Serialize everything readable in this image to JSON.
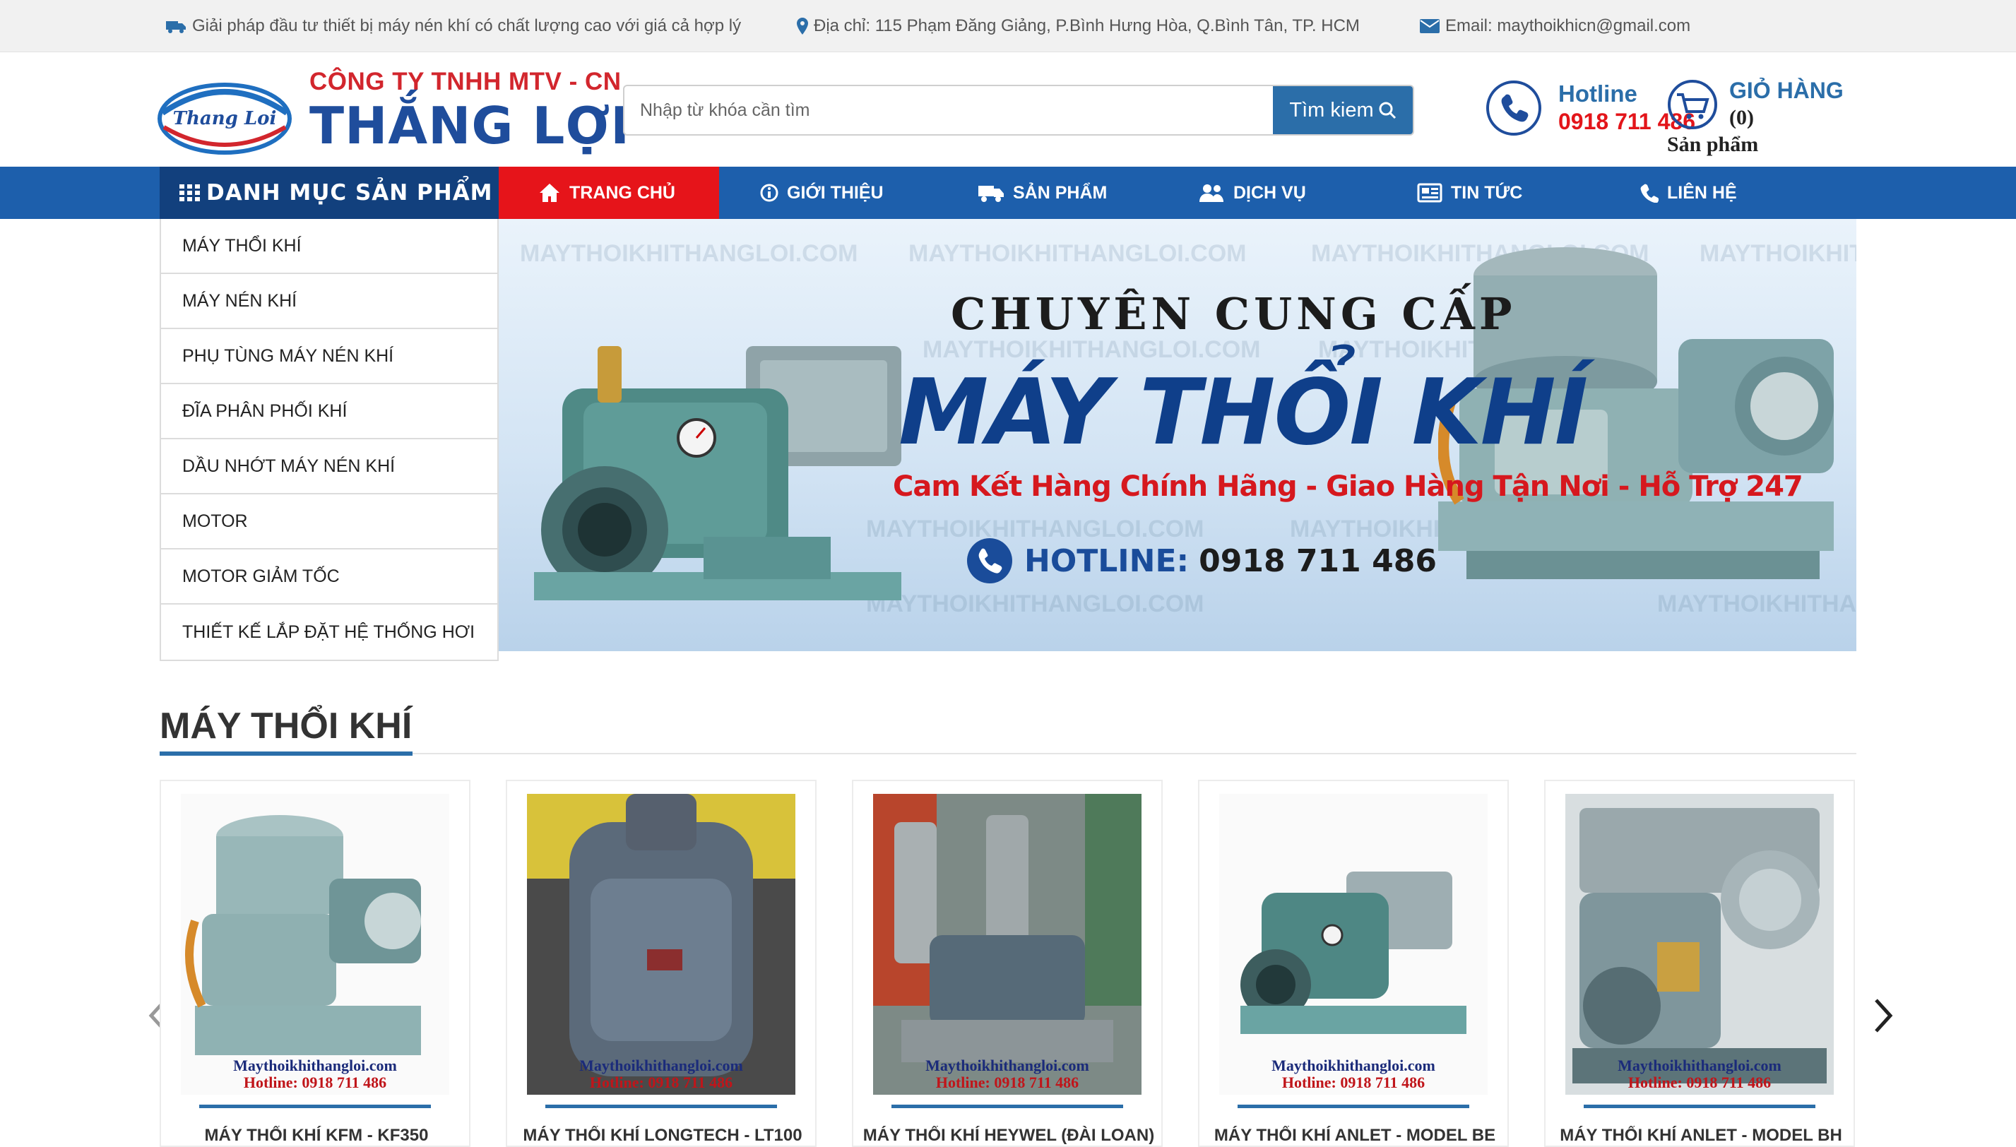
{
  "topbar": {
    "slogan": "Giải pháp đầu tư thiết bị máy nén khí có chất lượng cao với giá cả hợp lý",
    "address": "Địa chỉ: 115 Phạm Đăng Giảng, P.Bình Hưng Hòa, Q.Bình Tân, TP. HCM",
    "email": "Email: maythoikhicn@gmail.com"
  },
  "logo": {
    "oval_text": "Thang Loi",
    "company_line": "CÔNG TY TNHH MTV - CN",
    "company_name": "THẮNG LỢI"
  },
  "search": {
    "placeholder": "Nhập từ khóa cần tìm",
    "button_label": "Tìm kiem"
  },
  "hotline": {
    "label": "Hotline",
    "number": "0918 711 486"
  },
  "cart": {
    "label": "GIỎ HÀNG",
    "count": "(0)",
    "sub_label": "Sản phẩm"
  },
  "nav": {
    "category_label": "DANH MỤC SẢN PHẨM",
    "items": [
      {
        "label": "TRANG CHỦ",
        "icon": "home-icon"
      },
      {
        "label": "GIỚI THIỆU",
        "icon": "info-icon"
      },
      {
        "label": "SẢN PHẨM",
        "icon": "truck-icon"
      },
      {
        "label": "DỊCH VỤ",
        "icon": "service-icon"
      },
      {
        "label": "TIN TỨC",
        "icon": "news-icon"
      },
      {
        "label": "LIÊN HỆ",
        "icon": "phone-icon"
      }
    ]
  },
  "sidebar": {
    "items": [
      "MÁY THỔI KHÍ",
      "MÁY NÉN KHÍ",
      "PHỤ TÙNG MÁY NÉN KHÍ",
      "ĐĨA PHÂN PHỐI KHÍ",
      "DẦU NHỚT MÁY NÉN KHÍ",
      "MOTOR",
      "MOTOR GIẢM TỐC",
      "THIẾT KẾ LẮP ĐẶT HỆ THỐNG HƠI"
    ]
  },
  "banner": {
    "watermark": "MAYTHOIKHITHANGLOI.COM",
    "title_line1": "CHUYÊN CUNG CẤP",
    "title_line2": "MÁY THỔI KHÍ",
    "tagline": "Cam Kết Hàng Chính Hãng - Giao Hàng Tận Nơi - Hỗ Trợ 247",
    "hotline_label": "HOTLINE:",
    "hotline_number": "0918 711 486"
  },
  "section": {
    "title": "MÁY THỔI KHÍ",
    "watermark_site": "Maythoikhithangloi.com",
    "watermark_hotline": "Hotline: 0918 711 486"
  },
  "products": [
    {
      "name": "MÁY THỔI KHÍ KFM - KF350"
    },
    {
      "name": "MÁY THỔI KHÍ LONGTECH - LT100"
    },
    {
      "name": "MÁY THỔI KHÍ HEYWEL (ĐÀI LOAN)"
    },
    {
      "name": "MÁY THỔI KHÍ ANLET - MODEL BE"
    },
    {
      "name": "MÁY THỔI KHÍ ANLET - MODEL BH"
    }
  ],
  "colors": {
    "nav_blue": "#1d5fac",
    "nav_dark": "#12407d",
    "home_red": "#e6141a",
    "brand_blue": "#1f4d9c",
    "hotline_red": "#e3151a",
    "button_blue": "#2b6ea9"
  }
}
